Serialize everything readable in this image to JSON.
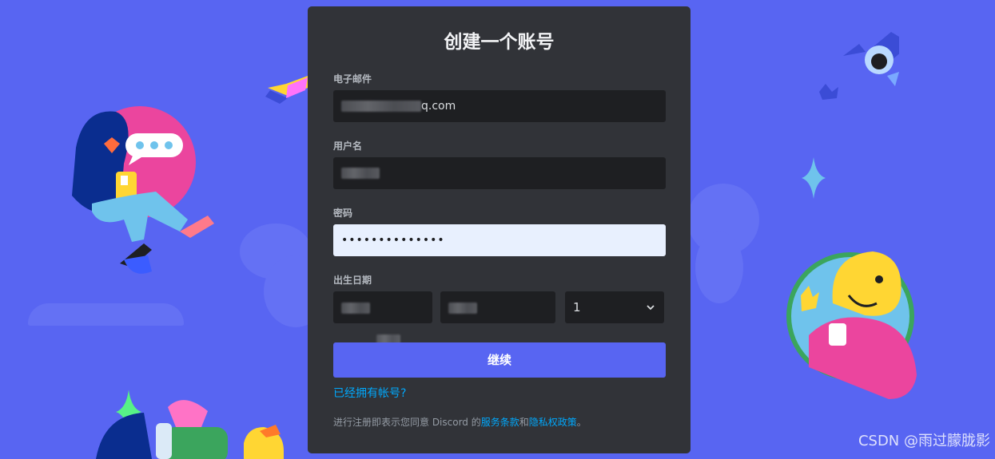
{
  "colors": {
    "background": "#5865f2",
    "card": "#313338",
    "input": "#1e1f22",
    "autofill": "#e8f0fe",
    "button": "#5865f2",
    "link": "#00a8fc"
  },
  "form": {
    "title": "创建一个账号",
    "email": {
      "label": "电子邮件",
      "value_suffix": "q.com"
    },
    "username": {
      "label": "用户名"
    },
    "password": {
      "label": "密码",
      "value": "••••••••••••••"
    },
    "birthdate": {
      "label": "出生日期",
      "day_value": "1"
    },
    "submit_label": "继续",
    "login_link": "已经拥有帐号?",
    "terms": {
      "prefix": "进行注册即表示您同意 Discord 的",
      "tos_link": "服务条款",
      "and": "和",
      "privacy_link": "隐私权政策",
      "suffix": "。"
    }
  },
  "watermark": "CSDN @雨过朦胧影",
  "icons": [
    "chevron-down-icon",
    "sparkle-icon",
    "speech-bubble-icon"
  ]
}
